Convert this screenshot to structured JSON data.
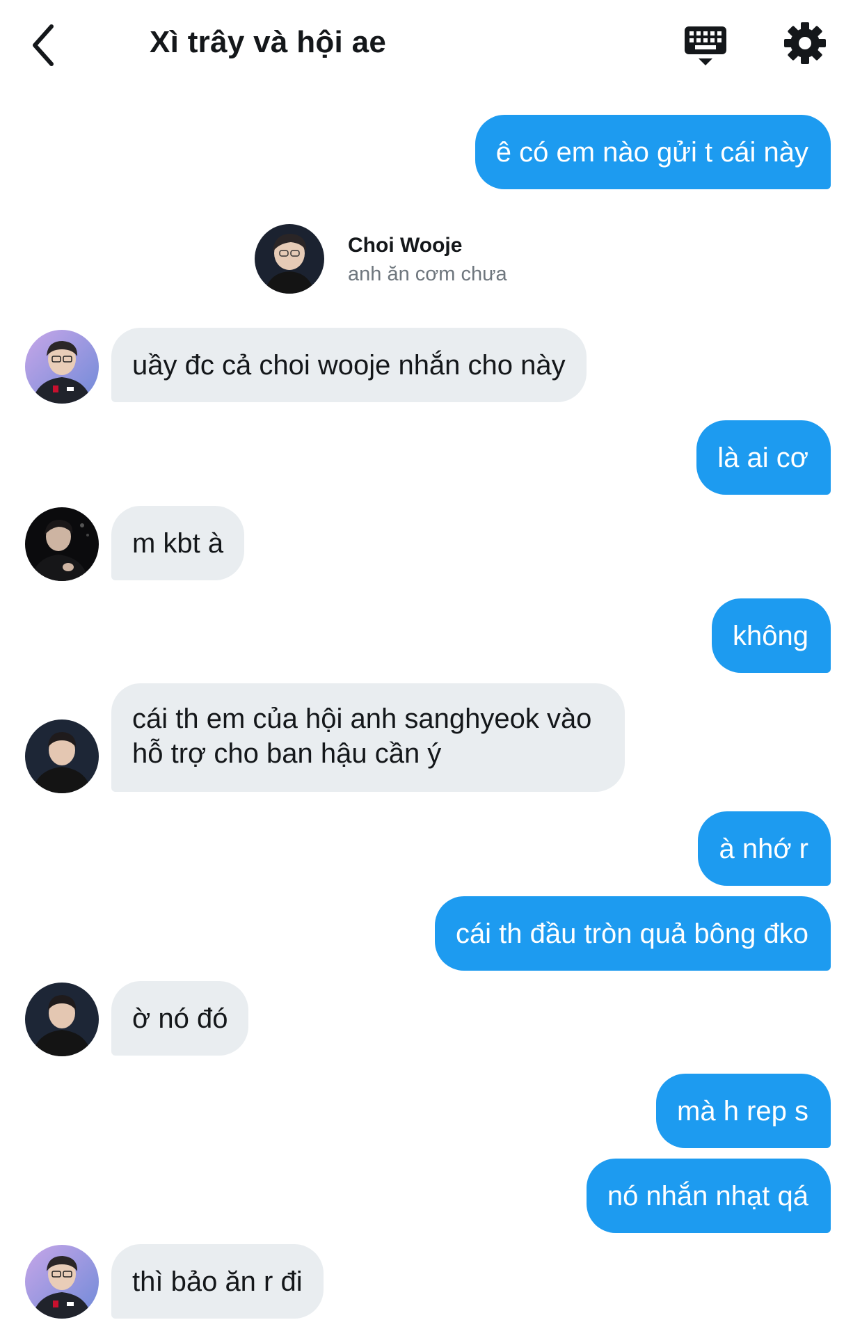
{
  "header": {
    "title": "Xì trây và hội ae",
    "back_icon": "chevron-left-icon",
    "keyboard_icon": "keyboard-icon",
    "settings_icon": "gear-icon"
  },
  "colors": {
    "outgoing_bubble": "#1d9bf0",
    "incoming_bubble": "#e9edf0",
    "text": "#14171a",
    "secondary_text": "#6e767d"
  },
  "shared_message": {
    "name": "Choi Wooje",
    "text": "anh ăn cơm chưa"
  },
  "messages": [
    {
      "direction": "out",
      "text": "ê có em nào gửi t cái này"
    },
    {
      "direction": "in",
      "text": "uầy đc cả choi wooje nhắn cho này"
    },
    {
      "direction": "out",
      "text": "là ai cơ"
    },
    {
      "direction": "in",
      "text": "m kbt à"
    },
    {
      "direction": "out",
      "text": "không"
    },
    {
      "direction": "in",
      "line1": "cái th em của hội anh sanghyeok vào",
      "line2": "hỗ trợ cho ban hậu cần ý"
    },
    {
      "direction": "out",
      "text": "à nhớ r"
    },
    {
      "direction": "out",
      "text": "cái th đầu tròn quả bông đko"
    },
    {
      "direction": "in",
      "text": "ờ nó đó"
    },
    {
      "direction": "out",
      "text": "mà h rep s"
    },
    {
      "direction": "out",
      "text": "nó nhắn nhạt qá"
    },
    {
      "direction": "in",
      "text": "thì bảo ăn r đi"
    }
  ]
}
